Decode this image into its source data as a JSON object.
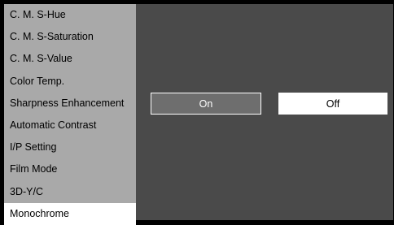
{
  "menu": {
    "items": [
      {
        "label": "C. M. S-Hue"
      },
      {
        "label": "C. M. S-Saturation"
      },
      {
        "label": "C. M. S-Value"
      },
      {
        "label": "Color Temp."
      },
      {
        "label": "Sharpness Enhancement"
      },
      {
        "label": "Automatic Contrast"
      },
      {
        "label": "I/P Setting"
      },
      {
        "label": "Film Mode"
      },
      {
        "label": "3D-Y/C"
      },
      {
        "label": "Monochrome"
      }
    ],
    "selected_index": 9
  },
  "options": {
    "on_label": "On",
    "off_label": "Off",
    "highlighted": "On"
  },
  "colors": {
    "menu_bg": "#a9a9a9",
    "selected_bg": "#ffffff",
    "content_bg": "#4a4a4a",
    "highlight_btn_bg": "#6e6e6e"
  }
}
